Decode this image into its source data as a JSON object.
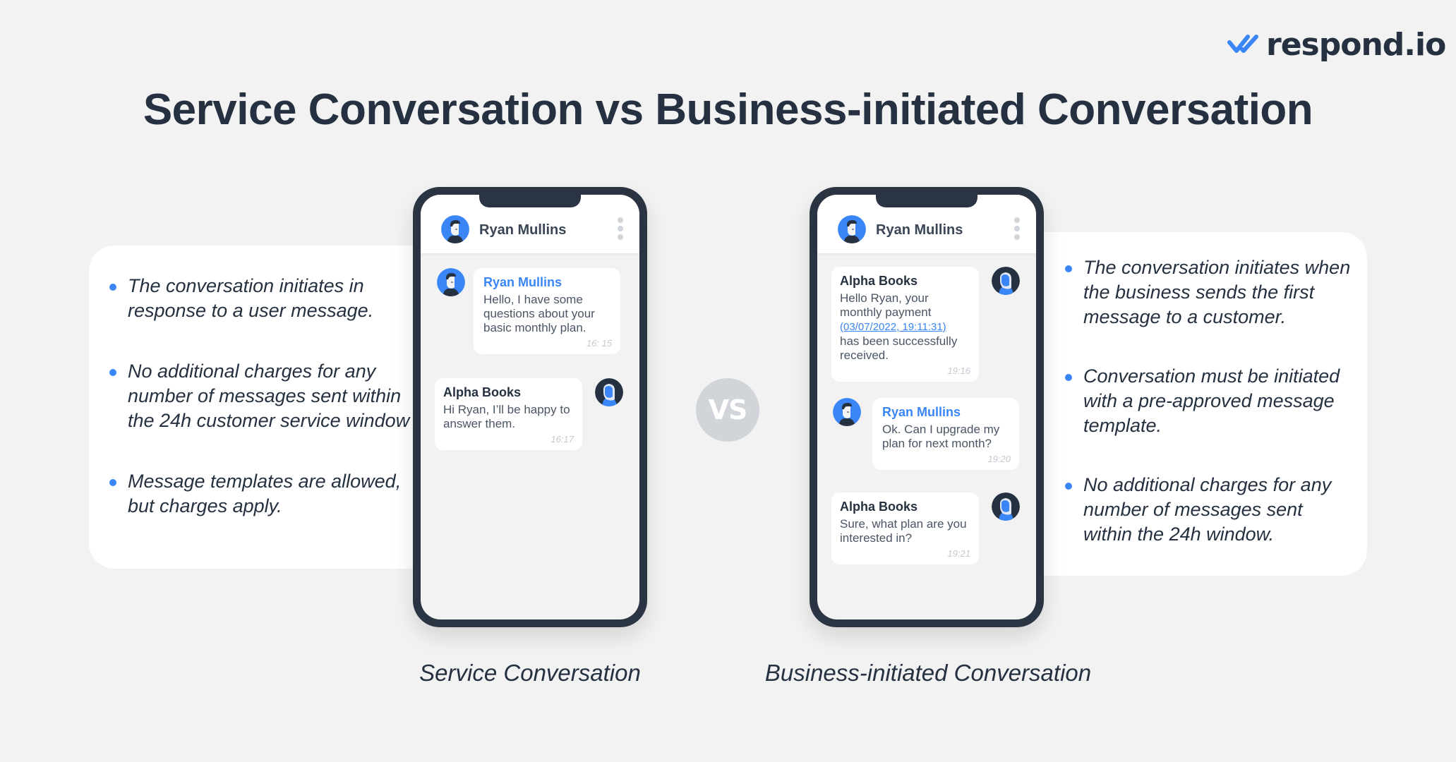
{
  "brand": {
    "name": "respond.io",
    "accent": "#3b86f6",
    "dark": "#253140"
  },
  "title": "Service Conversation vs Business-initiated Conversation",
  "vs_label": "VS",
  "left": {
    "caption": "Service Conversation",
    "points": [
      "The conversation initiates in response to a user message.",
      "No additional charges for any number of messages sent within the 24h customer service window",
      "Message templates are allowed, but charges apply."
    ],
    "phone": {
      "contact": "Ryan Mullins",
      "messages": [
        {
          "from": "user",
          "sender": "Ryan Mullins",
          "text": "Hello, I have some questions about your basic monthly plan.",
          "time": "16: 15"
        },
        {
          "from": "business",
          "sender": "Alpha Books",
          "text": "Hi Ryan, I’ll be happy to answer them.",
          "time": "16:17"
        }
      ]
    }
  },
  "right": {
    "caption": "Business-initiated Conversation",
    "points": [
      "The  conversation initiates when the business sends the first message to a customer.",
      "Conversation must be initiated with a pre-approved message template.",
      "No additional charges for any number of messages sent within the 24h window."
    ],
    "phone": {
      "contact": "Ryan Mullins",
      "messages": [
        {
          "from": "business",
          "sender": "Alpha Books",
          "text_before": "Hello Ryan, your monthly payment",
          "link": "(03/07/2022, 19:11:31)",
          "text_after": "has been successfully received.",
          "time": "19:16"
        },
        {
          "from": "user",
          "sender": "Ryan Mullins",
          "text": "Ok. Can I upgrade my plan for next month?",
          "time": "19:20"
        },
        {
          "from": "business",
          "sender": "Alpha Books",
          "text": "Sure, what plan are you interested in?",
          "time": "19:21"
        }
      ]
    }
  }
}
